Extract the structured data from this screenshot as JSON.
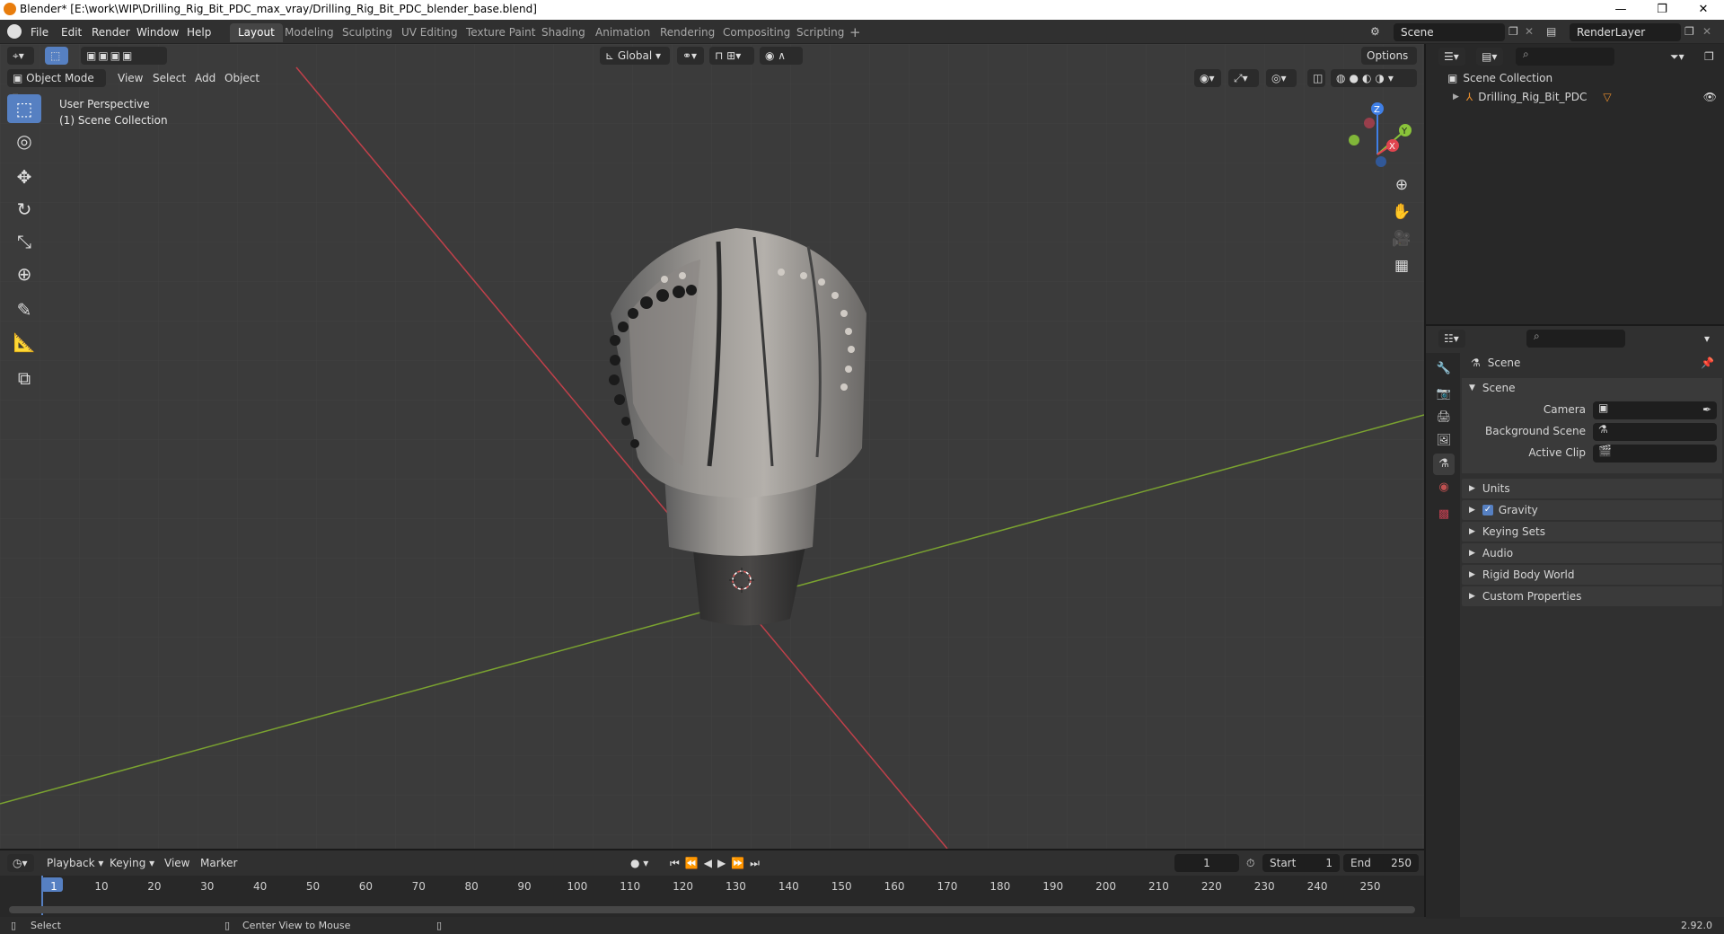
{
  "window": {
    "title": "Blender* [E:\\work\\WIP\\Drilling_Rig_Bit_PDC_max_vray/Drilling_Rig_Bit_PDC_blender_base.blend]"
  },
  "menu": [
    "File",
    "Edit",
    "Render",
    "Window",
    "Help"
  ],
  "workspaces": [
    "Layout",
    "Modeling",
    "Sculpting",
    "UV Editing",
    "Texture Paint",
    "Shading",
    "Animation",
    "Rendering",
    "Compositing",
    "Scripting"
  ],
  "scene_name": "Scene",
  "render_layer": "RenderLayer",
  "viewport": {
    "mode": "Object Mode",
    "menus": [
      "View",
      "Select",
      "Add",
      "Object"
    ],
    "orientation": "Global",
    "options_label": "Options",
    "overlay_title": "User Perspective",
    "overlay_collection": "(1) Scene Collection",
    "gizmo": {
      "z": "Z",
      "y": "Y",
      "x": "X"
    }
  },
  "outliner": {
    "root": "Scene Collection",
    "items": [
      {
        "label": "Drilling_Rig_Bit_PDC"
      }
    ]
  },
  "properties": {
    "header": "Scene",
    "panel": "Scene",
    "fields": [
      {
        "label": "Camera"
      },
      {
        "label": "Background Scene"
      },
      {
        "label": "Active Clip"
      }
    ],
    "sections": [
      "Units",
      "Gravity",
      "Keying Sets",
      "Audio",
      "Rigid Body World",
      "Custom Properties"
    ],
    "gravity_checked": true
  },
  "timeline": {
    "menus": [
      "Playback",
      "Keying",
      "View",
      "Marker"
    ],
    "current_frame": "1",
    "start_label": "Start",
    "start_value": "1",
    "end_label": "End",
    "end_value": "250",
    "ruler": [
      "1",
      "10",
      "20",
      "30",
      "40",
      "50",
      "60",
      "70",
      "80",
      "90",
      "100",
      "110",
      "120",
      "130",
      "140",
      "150",
      "160",
      "170",
      "180",
      "190",
      "200",
      "210",
      "220",
      "230",
      "240",
      "250"
    ]
  },
  "status": {
    "left": "Select",
    "middle": "Center View to Mouse",
    "version": "2.92.0"
  },
  "colors": {
    "accent": "#5680c2",
    "x_axis": "#e0444f",
    "y_axis": "#8ac43a",
    "z_axis": "#3f7fe6",
    "object_orange": "#e88d2c"
  }
}
